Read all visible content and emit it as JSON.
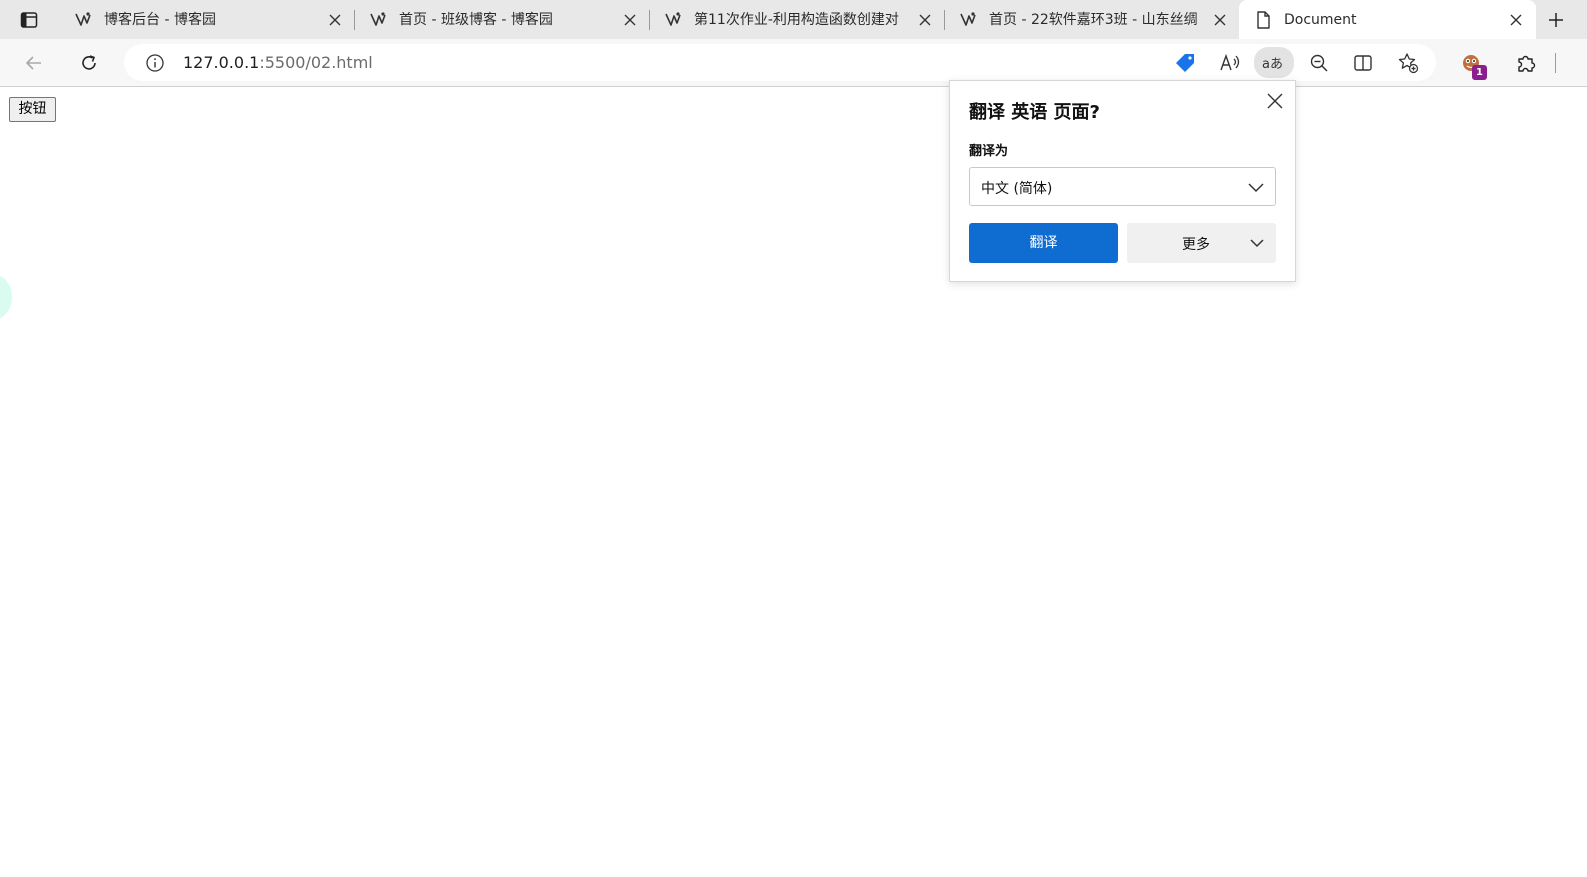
{
  "tabs": [
    {
      "title": "博客后台 - 博客园",
      "favicon": "cnblogs-icon"
    },
    {
      "title": "首页 - 班级博客 - 博客园",
      "favicon": "cnblogs-icon"
    },
    {
      "title": "第11次作业-利用构造函数创建对",
      "favicon": "cnblogs-icon"
    },
    {
      "title": "首页 - 22软件嘉环3班 - 山东丝绸",
      "favicon": "cnblogs-icon"
    },
    {
      "title": "Document",
      "favicon": "document-icon",
      "active": true
    }
  ],
  "address": {
    "host": "127.0.0.1",
    "path": ":5500/02.html"
  },
  "toolbar": {
    "extension_badge": "1"
  },
  "page": {
    "button_label": "按钮"
  },
  "translate_popup": {
    "title": "翻译 英语 页面?",
    "target_label": "翻译为",
    "target_language": "中文 (简体)",
    "translate_button": "翻译",
    "more_button": "更多"
  },
  "colors": {
    "accent": "#0f6cd0",
    "tab_strip": "#e8e8e8",
    "toolbar": "#f7f7f7",
    "badge": "#8b1d8f",
    "coupon_icon": "#1a73e8"
  }
}
